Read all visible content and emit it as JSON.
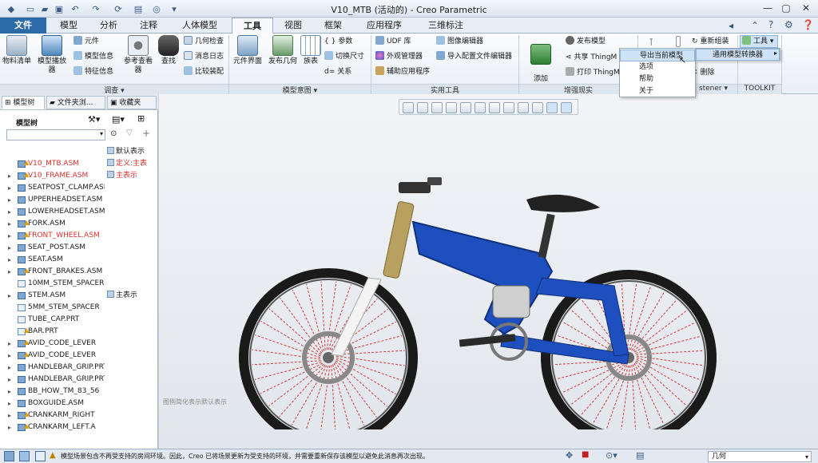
{
  "window": {
    "title": "V10_MTB (活动的) - Creo Parametric"
  },
  "tabs": [
    "文件",
    "模型",
    "分析",
    "注释",
    "人体模型",
    "工具",
    "视图",
    "框架",
    "应用程序",
    "三维标注"
  ],
  "active_tab": "工具",
  "ribbon": {
    "survey": {
      "label": "调查 ▾",
      "bom": "物料清单",
      "model_player": "模型播放器",
      "component": "元件",
      "model_info": "模型信息",
      "feature_info": "特征信息",
      "reference_viewer": "参考查看器",
      "find": "查找",
      "geometry_check": "几何检查",
      "message_log": "消息日志",
      "compare_assembly": "比较装配"
    },
    "intent": {
      "label": "模型意图 ▾",
      "component_interface": "元件界面",
      "publish_geometry": "发布几何",
      "family_table": "族表",
      "parameters": "参数",
      "switch_dimensions": "切换尺寸",
      "relations": "关系"
    },
    "utilities": {
      "label": "实用工具",
      "udf_library": "UDF 库",
      "appearance_manager": "外观管理器",
      "aux_apps": "辅助应用程序",
      "image_editor": "图像编辑器",
      "import_config_editor": "导入配置文件编辑器"
    },
    "ar": {
      "label": "增强现实",
      "add_thingmark": "添加\nThingMark",
      "publish_model": "发布模型",
      "share": "共享 ThingM",
      "print": "打印 ThingM"
    },
    "fastener": {
      "label": "stener ▾",
      "regenerate": "重新组装",
      "delete": "删除"
    },
    "toolkit": {
      "label": "TOOLKIT",
      "tool_button": "工具"
    }
  },
  "menus": {
    "tools_menu": [
      "导出当前模型",
      "选项",
      "帮助",
      "关于"
    ],
    "submenu": "通用模型转换器"
  },
  "left_panel": {
    "tabs": [
      "模型树",
      "文件夹浏...",
      "收藏夹"
    ],
    "tree_label": "模型树",
    "display_label": "默认表示",
    "items": [
      {
        "name": "V10_MTB.ASM",
        "note": "定义:主表",
        "red": true,
        "warn": true,
        "exp": "",
        "part": false
      },
      {
        "name": "V10_FRAME.ASM",
        "note": "主表示",
        "red": true,
        "warn": true,
        "exp": "▸",
        "part": false
      },
      {
        "name": "SEATPOST_CLAMP.ASM",
        "note": "",
        "red": false,
        "warn": false,
        "exp": "▸",
        "part": false
      },
      {
        "name": "UPPERHEADSET.ASM",
        "note": "",
        "red": false,
        "warn": false,
        "exp": "▸",
        "part": false
      },
      {
        "name": "LOWERHEADSET.ASM",
        "note": "",
        "red": false,
        "warn": false,
        "exp": "▸",
        "part": false
      },
      {
        "name": "FORK.ASM",
        "note": "",
        "red": false,
        "warn": true,
        "exp": "▸",
        "part": false
      },
      {
        "name": "FRONT_WHEEL.ASM",
        "note": "",
        "red": true,
        "warn": true,
        "exp": "▸",
        "part": false
      },
      {
        "name": "SEAT_POST.ASM",
        "note": "",
        "red": false,
        "warn": false,
        "exp": "▸",
        "part": false
      },
      {
        "name": "SEAT.ASM",
        "note": "",
        "red": false,
        "warn": false,
        "exp": "▸",
        "part": false
      },
      {
        "name": "FRONT_BRAKES.ASM",
        "note": "",
        "red": false,
        "warn": true,
        "exp": "▸",
        "part": false
      },
      {
        "name": "10MM_STEM_SPACER",
        "note": "",
        "red": false,
        "warn": false,
        "exp": "",
        "part": true
      },
      {
        "name": "STEM.ASM",
        "note": "主表示",
        "red": false,
        "warn": false,
        "exp": "▸",
        "part": false
      },
      {
        "name": "5MM_STEM_SPACER",
        "note": "",
        "red": false,
        "warn": false,
        "exp": "",
        "part": true
      },
      {
        "name": "TUBE_CAP.PRT",
        "note": "",
        "red": false,
        "warn": false,
        "exp": "",
        "part": true
      },
      {
        "name": "BAR.PRT",
        "note": "",
        "red": false,
        "warn": true,
        "exp": "",
        "part": true
      },
      {
        "name": "AVID_CODE_LEVER",
        "note": "",
        "red": false,
        "warn": true,
        "exp": "▸",
        "part": false
      },
      {
        "name": "AVID_CODE_LEVER",
        "note": "",
        "red": false,
        "warn": true,
        "exp": "▸",
        "part": false
      },
      {
        "name": "HANDLEBAR_GRIP.PRT",
        "note": "",
        "red": false,
        "warn": false,
        "exp": "▸",
        "part": false
      },
      {
        "name": "HANDLEBAR_GRIP.PRT",
        "note": "",
        "red": false,
        "warn": false,
        "exp": "▸",
        "part": false
      },
      {
        "name": "BB_HOW_TM_83_56",
        "note": "",
        "red": false,
        "warn": false,
        "exp": "▸",
        "part": false
      },
      {
        "name": "BOXGUIDE.ASM",
        "note": "",
        "red": false,
        "warn": false,
        "exp": "▸",
        "part": false
      },
      {
        "name": "CRANKARM_RIGHT",
        "note": "",
        "red": false,
        "warn": true,
        "exp": "▸",
        "part": false
      },
      {
        "name": "CRANKARM_LEFT.A",
        "note": "",
        "red": false,
        "warn": true,
        "exp": "▸",
        "part": false
      }
    ]
  },
  "graphics": {
    "view_note": "图例简化表示默认表示"
  },
  "status": {
    "message": "模型场景包含不再受支持的房间环境。因此，Creo 已将场景更新为受支持的环境，并需要重新保存该模型以避免此消息再次出现。",
    "filter": "几何"
  }
}
